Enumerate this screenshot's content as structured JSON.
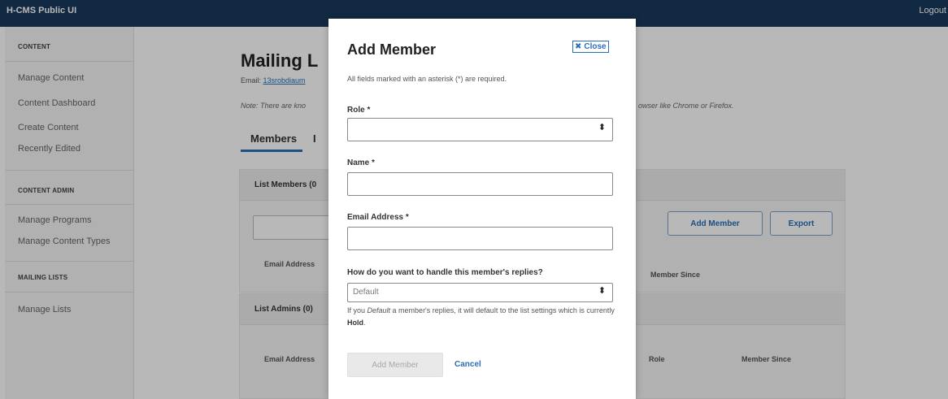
{
  "topbar": {
    "app_name": "H-CMS Public UI",
    "logout": "Logout"
  },
  "sidebar": {
    "sections": [
      {
        "title": "CONTENT",
        "items": [
          "Manage Content",
          "Content Dashboard",
          "Create Content",
          "Recently Edited"
        ]
      },
      {
        "title": "CONTENT ADMIN",
        "items": [
          "Manage Programs",
          "Manage Content Types"
        ]
      },
      {
        "title": "MAILING LISTS",
        "items": [
          "Manage Lists"
        ]
      }
    ]
  },
  "main": {
    "title_visible": "Mailing L",
    "email_prefix": "Email: ",
    "email_link_visible": "13srobdiaum",
    "note_left": "Note: There are kno",
    "note_right": "owser like Chrome or Firefox.",
    "tabs": [
      {
        "label": "Members",
        "active": true
      },
      {
        "label": "I",
        "active": false
      }
    ],
    "list_members": {
      "title_visible": "List Members (0",
      "add_member_button": "Add Member",
      "export_button": "Export",
      "columns": [
        "Email Address",
        "Member Since"
      ]
    },
    "list_admins": {
      "title": "List Admins (0)",
      "columns": [
        "Email Address",
        "Role",
        "Member Since"
      ]
    }
  },
  "modal": {
    "title": "Add Member",
    "close_label": "Close",
    "required_note": "All fields marked with an asterisk (*) are required.",
    "role_label": "Role *",
    "role_value": "",
    "name_label": "Name *",
    "name_value": "",
    "email_label": "Email Address *",
    "email_value": "",
    "replies_label": "How do you want to handle this member's replies?",
    "replies_value": "Default",
    "help_prefix": "If you ",
    "help_em": "Default",
    "help_middle": " a member's replies, it will default to the list settings which is currently ",
    "help_strong": "Hold",
    "help_suffix": ".",
    "add_button": "Add Member",
    "cancel_button": "Cancel"
  },
  "colors": {
    "topbar": "#1a3a5e",
    "link": "#2a6fb5",
    "overlay": "rgba(0,0,0,0.28)"
  },
  "icons": {
    "close": "close-icon",
    "select": "select-arrows-icon"
  }
}
